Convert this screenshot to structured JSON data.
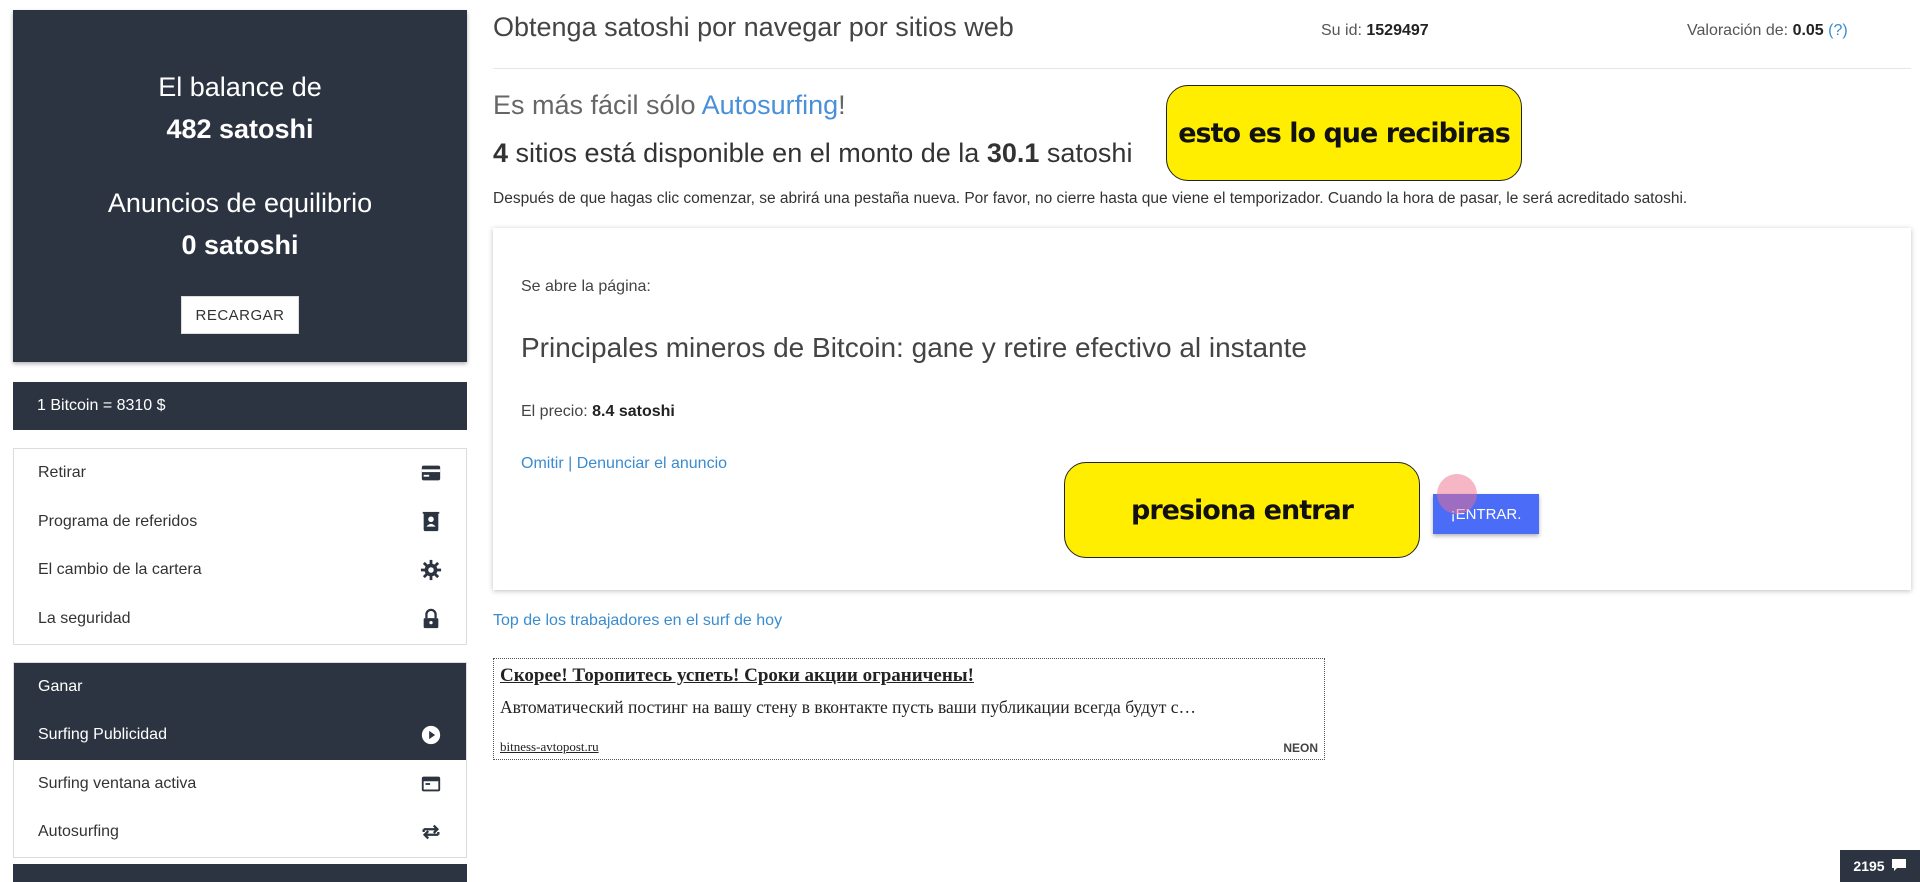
{
  "sidebar": {
    "balance_label": "El balance de",
    "balance_value": "482 satoshi",
    "ads_label": "Anuncios de equilibrio",
    "ads_value": "0 satoshi",
    "reload_label": "RECARGAR",
    "rate": "1 Bitcoin = 8310 $",
    "account_items": [
      {
        "label": "Retirar",
        "icon": "credit-card-icon"
      },
      {
        "label": "Programa de referidos",
        "icon": "contact-book-icon"
      },
      {
        "label": "El cambio de la cartera",
        "icon": "gear-icon"
      },
      {
        "label": "La seguridad",
        "icon": "lock-icon"
      }
    ],
    "earn_header": "Ganar",
    "earn_items": [
      {
        "label": "Surfing Publicidad",
        "icon": "play-circle-icon",
        "active": true
      },
      {
        "label": "Surfing ventana activa",
        "icon": "window-icon",
        "active": false
      },
      {
        "label": "Autosurfing",
        "icon": "repeat-icon",
        "active": false
      }
    ]
  },
  "header": {
    "title": "Obtenga satoshi por navegar por sitios web",
    "user_id_label": "Su id:",
    "user_id_value": "1529497",
    "rating_label": "Valoración de:",
    "rating_value": "0.05",
    "rating_help": "(?)"
  },
  "main": {
    "easier_prefix": "Es más fácil sólo ",
    "easier_link": "Autosurfing",
    "easier_suffix": "!",
    "sites_count": "4",
    "sites_mid": " sitios está disponible en el monto de la ",
    "sites_amount": "30.1",
    "sites_unit": " satoshi",
    "notice": "Después de que hagas clic comenzar, se abrirá una pestaña nueva. Por favor, no cierre hasta que viene el temporizador. Cuando la hora de pasar, le será acreditado satoshi.",
    "ad": {
      "opens_label": "Se abre la página:",
      "title": "Principales mineros de Bitcoin: gane y retire efectivo al instante",
      "price_label": "El precio:",
      "price_value": "8.4 satoshi",
      "skip": "Omitir",
      "separator": " | ",
      "report": "Denunciar el anuncio",
      "enter_label": "¡ENTRAR."
    },
    "top_workers": "Top de los trabajadores en el surf de hoy",
    "promo": {
      "title": "Скорее! Торопитесь успеть! Сроки акции ограничены!",
      "text": "Автоматический постинг на вашу стену в вконтакте пусть ваши публикации всегда будут с…",
      "domain": "bitness-avtopost.ru",
      "brand": "NEON"
    }
  },
  "callouts": {
    "receive": "esto es lo que recibiras",
    "press": "presiona entrar"
  },
  "badge": {
    "count": "2195"
  },
  "colors": {
    "sidebar_dark": "#2d3441",
    "link_blue": "#3a8cd0",
    "enter_button": "#4a6cf7",
    "callout_yellow": "#ffee00"
  }
}
